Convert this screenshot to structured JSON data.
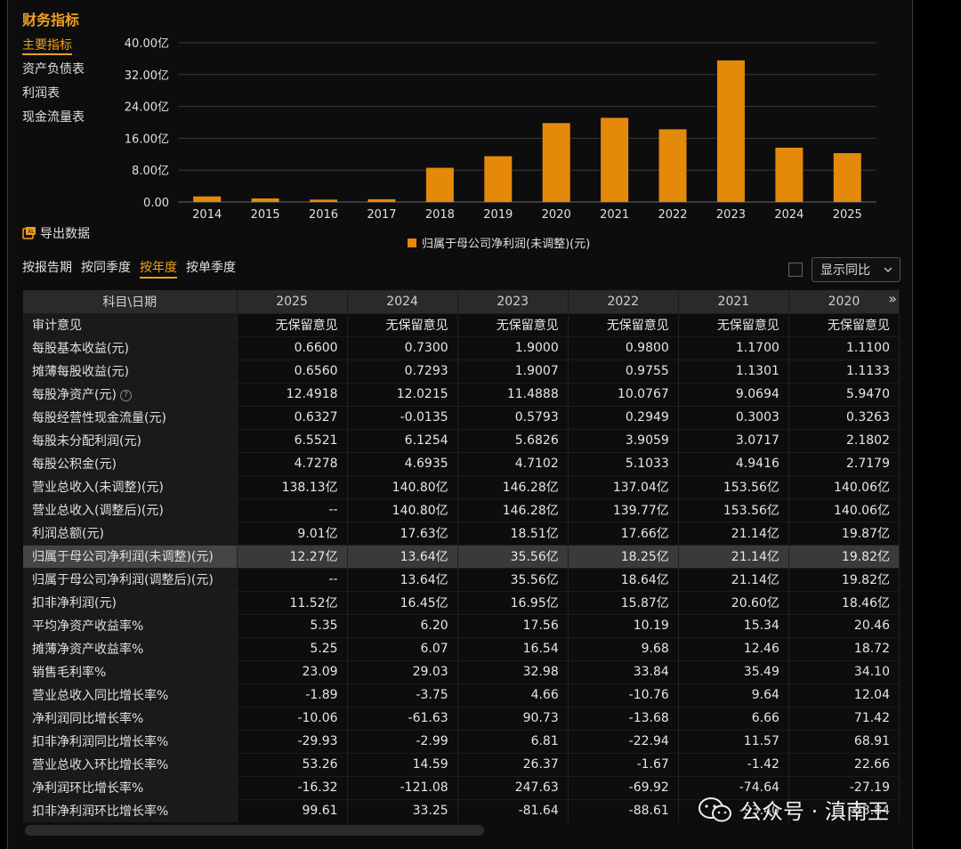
{
  "title": "财务指标",
  "sidebar": {
    "items": [
      {
        "label": "主要指标",
        "active": true
      },
      {
        "label": "资产负债表",
        "active": false
      },
      {
        "label": "利润表",
        "active": false
      },
      {
        "label": "现金流量表",
        "active": false
      }
    ]
  },
  "export_label": "导出数据",
  "chart_data": {
    "type": "bar",
    "categories": [
      "2014",
      "2015",
      "2016",
      "2017",
      "2018",
      "2019",
      "2020",
      "2021",
      "2022",
      "2023",
      "2024",
      "2025"
    ],
    "series": [
      {
        "name": "归属于母公司净利润(未调整)(元)",
        "values": [
          1.4,
          0.9,
          0.6,
          0.7,
          8.6,
          11.5,
          19.82,
          21.14,
          18.25,
          35.56,
          13.64,
          12.27
        ],
        "color": "#e5890a"
      }
    ],
    "ylim": [
      0,
      40
    ],
    "yticks": [
      "0.00",
      "8.00亿",
      "16.00亿",
      "24.00亿",
      "32.00亿",
      "40.00亿"
    ],
    "ytick_values": [
      0,
      8,
      16,
      24,
      32,
      40
    ],
    "grid": true,
    "legend": "bottom"
  },
  "tabs": [
    {
      "label": "按报告期",
      "active": false
    },
    {
      "label": "按同季度",
      "active": false
    },
    {
      "label": "按年度",
      "active": true
    },
    {
      "label": "按单季度",
      "active": false
    }
  ],
  "yoy_label": "显示同比",
  "table": {
    "header_label": "科目\\日期",
    "columns": [
      "2025",
      "2024",
      "2023",
      "2022",
      "2021",
      "2020"
    ],
    "rows": [
      {
        "label": "审计意见",
        "values": [
          "无保留意见",
          "无保留意见",
          "无保留意见",
          "无保留意见",
          "无保留意见",
          "无保留意见"
        ]
      },
      {
        "label": "每股基本收益(元)",
        "values": [
          "0.6600",
          "0.7300",
          "1.9000",
          "0.9800",
          "1.1700",
          "1.1100"
        ]
      },
      {
        "label": "摊薄每股收益(元)",
        "values": [
          "0.6560",
          "0.7293",
          "1.9007",
          "0.9755",
          "1.1301",
          "1.1133"
        ]
      },
      {
        "label": "每股净资产(元)",
        "help": true,
        "values": [
          "12.4918",
          "12.0215",
          "11.4888",
          "10.0767",
          "9.0694",
          "5.9470"
        ]
      },
      {
        "label": "每股经营性现金流量(元)",
        "values": [
          "0.6327",
          "-0.0135",
          "0.5793",
          "0.2949",
          "0.3003",
          "0.3263"
        ]
      },
      {
        "label": "每股未分配利润(元)",
        "values": [
          "6.5521",
          "6.1254",
          "5.6826",
          "3.9059",
          "3.0717",
          "2.1802"
        ]
      },
      {
        "label": "每股公积金(元)",
        "values": [
          "4.7278",
          "4.6935",
          "4.7102",
          "5.1033",
          "4.9416",
          "2.7179"
        ]
      },
      {
        "label": "营业总收入(未调整)(元)",
        "values": [
          "138.13亿",
          "140.80亿",
          "146.28亿",
          "137.04亿",
          "153.56亿",
          "140.06亿"
        ]
      },
      {
        "label": "营业总收入(调整后)(元)",
        "values": [
          "--",
          "140.80亿",
          "146.28亿",
          "139.77亿",
          "153.56亿",
          "140.06亿"
        ]
      },
      {
        "label": "利润总额(元)",
        "values": [
          "9.01亿",
          "17.63亿",
          "18.51亿",
          "17.66亿",
          "21.14亿",
          "19.87亿"
        ]
      },
      {
        "label": "归属于母公司净利润(未调整)(元)",
        "highlight": true,
        "values": [
          "12.27亿",
          "13.64亿",
          "35.56亿",
          "18.25亿",
          "21.14亿",
          "19.82亿"
        ]
      },
      {
        "label": "归属于母公司净利润(调整后)(元)",
        "values": [
          "--",
          "13.64亿",
          "35.56亿",
          "18.64亿",
          "21.14亿",
          "19.82亿"
        ]
      },
      {
        "label": "扣非净利润(元)",
        "values": [
          "11.52亿",
          "16.45亿",
          "16.95亿",
          "15.87亿",
          "20.60亿",
          "18.46亿"
        ]
      },
      {
        "label": "平均净资产收益率%",
        "values": [
          "5.35",
          "6.20",
          "17.56",
          "10.19",
          "15.34",
          "20.46"
        ]
      },
      {
        "label": "摊薄净资产收益率%",
        "values": [
          "5.25",
          "6.07",
          "16.54",
          "9.68",
          "12.46",
          "18.72"
        ]
      },
      {
        "label": "销售毛利率%",
        "values": [
          "23.09",
          "29.03",
          "32.98",
          "33.84",
          "35.49",
          "34.10"
        ]
      },
      {
        "label": "营业总收入同比增长率%",
        "values": [
          "-1.89",
          "-3.75",
          "4.66",
          "-10.76",
          "9.64",
          "12.04"
        ]
      },
      {
        "label": "净利润同比增长率%",
        "values": [
          "-10.06",
          "-61.63",
          "90.73",
          "-13.68",
          "6.66",
          "71.42"
        ]
      },
      {
        "label": "扣非净利润同比增长率%",
        "values": [
          "-29.93",
          "-2.99",
          "6.81",
          "-22.94",
          "11.57",
          "68.91"
        ]
      },
      {
        "label": "营业总收入环比增长率%",
        "values": [
          "53.26",
          "14.59",
          "26.37",
          "-1.67",
          "-1.42",
          "22.66"
        ]
      },
      {
        "label": "净利润环比增长率%",
        "values": [
          "-16.32",
          "-121.08",
          "247.63",
          "-69.92",
          "-74.64",
          "-27.19"
        ]
      },
      {
        "label": "扣非净利润环比增长率%",
        "values": [
          "99.61",
          "33.25",
          "-81.64",
          "-88.61",
          "-93.40",
          "-63.84"
        ]
      }
    ]
  },
  "watermark": "公众号 · 滇南王"
}
